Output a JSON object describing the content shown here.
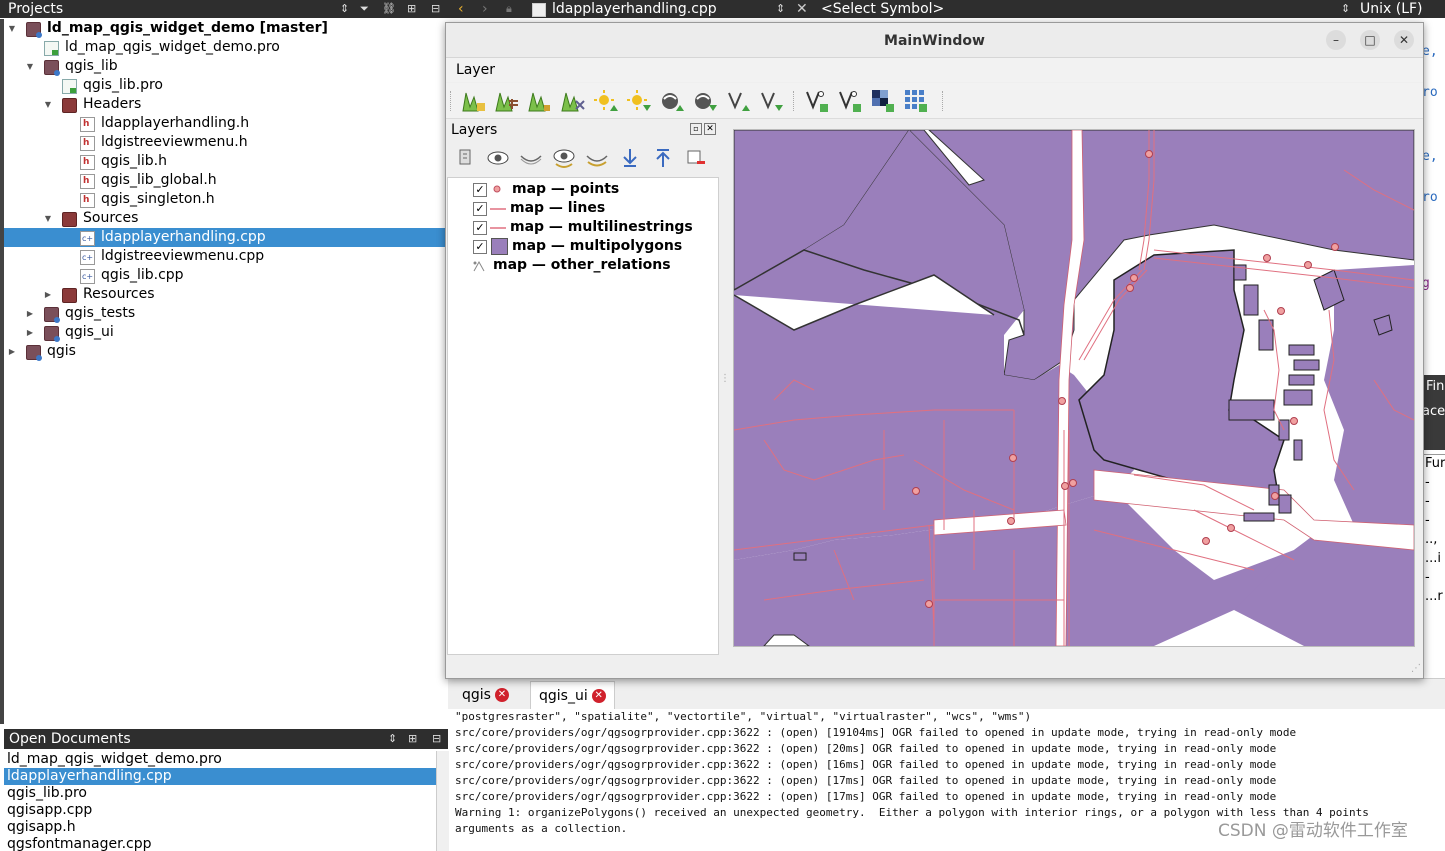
{
  "projects": {
    "header": "Projects",
    "tree": [
      {
        "label": "ld_map_qgis_widget_demo [master]",
        "icon": "project-icon",
        "bold": true,
        "arrow": "down"
      },
      {
        "label": "ld_map_qgis_widget_demo.pro",
        "icon": "pro-file-icon"
      },
      {
        "label": "qgis_lib",
        "icon": "project-icon",
        "arrow": "down"
      },
      {
        "label": "qgis_lib.pro",
        "icon": "pro-file-icon"
      },
      {
        "label": "Headers",
        "icon": "folder-icon",
        "arrow": "down"
      },
      {
        "label": "ldapplayerhandling.h",
        "icon": "header-file-icon"
      },
      {
        "label": "ldgistreeviewmenu.h",
        "icon": "header-file-icon"
      },
      {
        "label": "qgis_lib.h",
        "icon": "header-file-icon"
      },
      {
        "label": "qgis_lib_global.h",
        "icon": "header-file-icon"
      },
      {
        "label": "qgis_singleton.h",
        "icon": "header-file-icon"
      },
      {
        "label": "Sources",
        "icon": "folder-icon",
        "arrow": "down"
      },
      {
        "label": "ldapplayerhandling.cpp",
        "icon": "cpp-file-icon",
        "selected": true
      },
      {
        "label": "ldgistreeviewmenu.cpp",
        "icon": "cpp-file-icon"
      },
      {
        "label": "qgis_lib.cpp",
        "icon": "cpp-file-icon"
      },
      {
        "label": "Resources",
        "icon": "folder-icon",
        "arrow": "right"
      },
      {
        "label": "qgis_tests",
        "icon": "project-icon",
        "arrow": "right"
      },
      {
        "label": "qgis_ui",
        "icon": "project-icon",
        "arrow": "right"
      },
      {
        "label": "qgis",
        "icon": "project-icon",
        "arrow": "right"
      }
    ]
  },
  "open_documents": {
    "header": "Open Documents",
    "items": [
      {
        "label": "ld_map_qgis_widget_demo.pro"
      },
      {
        "label": "ldapplayerhandling.cpp",
        "selected": true
      },
      {
        "label": "qgis_lib.pro"
      },
      {
        "label": "qgisapp.cpp"
      },
      {
        "label": "qgisapp.h"
      },
      {
        "label": "qgsfontmanager.cpp"
      }
    ]
  },
  "editor_toolbar": {
    "file_name": "ldapplayerhandling.cpp",
    "symbol_selector": "<Select Symbol>",
    "line_ending": "Unix (LF)"
  },
  "editor_fragments": {
    "lines": [
      "e,",
      "ro",
      "e,",
      "ro",
      "g"
    ],
    "dark_labels": [
      "Fin",
      "ace",
      "Fur"
    ],
    "list_lines": [
      "-",
      "-",
      "-",
      "..,",
      "...i",
      "-",
      "...r"
    ]
  },
  "main_window": {
    "title": "MainWindow",
    "menu": "Layer",
    "layers_title": "Layers",
    "layers": [
      {
        "name": "map — points",
        "checked": true,
        "symbol": "point"
      },
      {
        "name": "map — lines",
        "checked": true,
        "symbol": "line"
      },
      {
        "name": "map — multilinestrings",
        "checked": true,
        "symbol": "line"
      },
      {
        "name": "map — multipolygons",
        "checked": true,
        "symbol": "polygon"
      },
      {
        "name": "map — other_relations",
        "checked": false,
        "symbol": "none"
      }
    ],
    "colors": {
      "polygon_fill": "#9a7fbb",
      "line": "#e07080",
      "point": "#f0a0a0"
    }
  },
  "output": {
    "tabs": [
      {
        "label": "qgis",
        "active": false
      },
      {
        "label": "qgis_ui",
        "active": true
      }
    ],
    "lines": [
      "\"postgresraster\", \"spatialite\", \"vectortile\", \"virtual\", \"virtualraster\", \"wcs\", \"wms\")",
      "src/core/providers/ogr/qgsogrprovider.cpp:3622 : (open) [19104ms] OGR failed to opened in update mode, trying in read-only mode",
      "src/core/providers/ogr/qgsogrprovider.cpp:3622 : (open) [20ms] OGR failed to opened in update mode, trying in read-only mode",
      "src/core/providers/ogr/qgsogrprovider.cpp:3622 : (open) [16ms] OGR failed to opened in update mode, trying in read-only mode",
      "src/core/providers/ogr/qgsogrprovider.cpp:3622 : (open) [17ms] OGR failed to opened in update mode, trying in read-only mode",
      "src/core/providers/ogr/qgsogrprovider.cpp:3622 : (open) [17ms] OGR failed to opened in update mode, trying in read-only mode",
      "Warning 1: organizePolygons() received an unexpected geometry.  Either a polygon with interior rings, or a polygon with less than 4 points",
      "arguments as a collection."
    ]
  },
  "watermark": "CSDN @雷动软件工作室"
}
